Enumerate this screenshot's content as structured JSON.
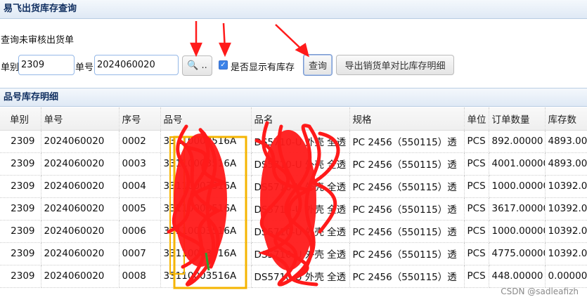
{
  "window": {
    "title": "易飞出货库存查询"
  },
  "form": {
    "unapproved_label": "查询未审核出货单",
    "type_label": "单别",
    "type_value": "2309",
    "number_label": "单号",
    "number_value": "2024060020",
    "lookup_button": "🔍 ..",
    "stock_checkbox_label": "是否显示有库存",
    "stock_checkbox_checked": true,
    "query_button": "查询",
    "export_button": "导出销货单对比库存明细"
  },
  "grid": {
    "title": "品号库存明细",
    "columns": [
      "单别",
      "单号",
      "序号",
      "品号",
      "品名",
      "规格",
      "单位",
      "订单数量",
      "库存数"
    ],
    "rows": [
      [
        "2309",
        "2024060020",
        "0002",
        "33110003516A",
        "DS5710-U 外壳 全透",
        "PC 2456（550115）透",
        "PCS",
        "892.00000",
        "4893.00"
      ],
      [
        "2309",
        "2024060020",
        "0003",
        "33110003516A",
        "DS5710-U 外壳 全透",
        "PC 2456（550115）透",
        "PCS",
        "4001.00000",
        "4893.00"
      ],
      [
        "2309",
        "2024060020",
        "0004",
        "33110003516A",
        "DS5710-U 外壳 全透",
        "PC 2456（550115）透",
        "PCS",
        "1000.00000",
        "10392.0"
      ],
      [
        "2309",
        "2024060020",
        "0005",
        "33110003516A",
        "DS5710-U 外壳 全透",
        "PC 2456（550115）透",
        "PCS",
        "3617.00000",
        "10392.0"
      ],
      [
        "2309",
        "2024060020",
        "0006",
        "33110003516A",
        "DS5710-U 外壳 全透",
        "PC 2456（550115）透",
        "PCS",
        "1000.00000",
        "10392.0"
      ],
      [
        "2309",
        "2024060020",
        "0007",
        "33110003516A",
        "DS5710-U 外壳 全透",
        "PC 2456（550115）透",
        "PCS",
        "4775.00000",
        "10392.0"
      ],
      [
        "2309",
        "2024060020",
        "0008",
        "33110003516A",
        "DS5710-U 外壳 全透",
        "PC 2456（550115）透",
        "PCS",
        "448.00000",
        "0.00000"
      ]
    ]
  },
  "watermark": "CSDN @sadleafizh",
  "colors": {
    "header_text": "#0e2d5f",
    "annotation_red": "#ff1a1a",
    "highlight_orange": "#f5b400"
  }
}
